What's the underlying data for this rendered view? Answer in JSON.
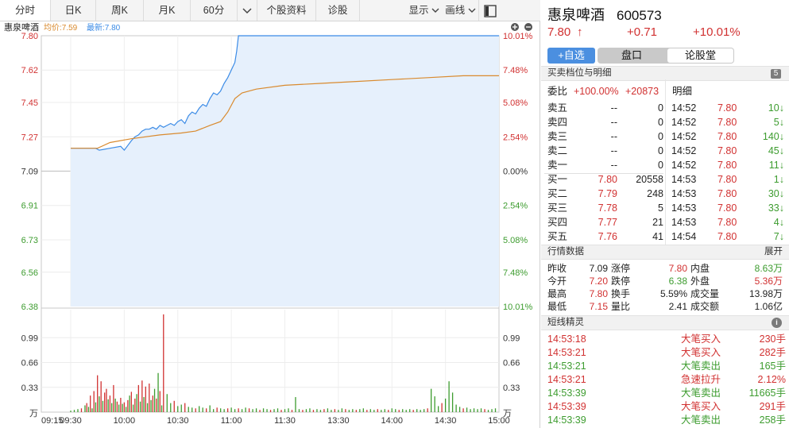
{
  "toolbar": {
    "tabs": [
      "分时",
      "日K",
      "周K",
      "月K",
      "60分"
    ],
    "dropdown_icon": "chevron-down-icon",
    "tabs2": [
      "个股资料",
      "诊股"
    ],
    "display_label": "显示",
    "draw_label": "画线",
    "layout_icon": "panel-toggle-icon"
  },
  "chart_header": {
    "name": "惠泉啤酒",
    "avg_label": "均价:7.59",
    "latest_label": "最新:7.80",
    "zoom_in_icon": "plus-circle-icon",
    "zoom_out_icon": "minus-circle-icon"
  },
  "colors": {
    "up": "#d13131",
    "down": "#3d9c2f",
    "price_line": "#3b8be6",
    "avg_line": "#d98a2e",
    "fill": "#e6f0fc"
  },
  "chart_data": [
    {
      "type": "line",
      "title": "",
      "y_left_ticks": [
        "7.80",
        "7.62",
        "7.45",
        "7.27",
        "7.09",
        "6.91",
        "6.73",
        "6.56",
        "6.38"
      ],
      "y_right_ticks": [
        "10.01%",
        "7.48%",
        "5.08%",
        "2.54%",
        "0.00%",
        "2.54%",
        "5.08%",
        "7.48%",
        "10.01%"
      ],
      "ylim": [
        6.38,
        7.8
      ],
      "x_ticks": [
        "09:15",
        "09:30",
        "10:00",
        "10:30",
        "11:00",
        "11:30",
        "13:30",
        "14:00",
        "14:30",
        "15:00"
      ],
      "series": [
        {
          "name": "最新",
          "points": [
            [
              0,
              7.21
            ],
            [
              14,
              7.21
            ],
            [
              16,
              7.2
            ],
            [
              22,
              7.21
            ],
            [
              28,
              7.22
            ],
            [
              30,
              7.2
            ],
            [
              34,
              7.25
            ],
            [
              36,
              7.27
            ],
            [
              38,
              7.28
            ],
            [
              40,
              7.3
            ],
            [
              42,
              7.31
            ],
            [
              44,
              7.31
            ],
            [
              46,
              7.32
            ],
            [
              48,
              7.31
            ],
            [
              50,
              7.33
            ],
            [
              52,
              7.32
            ],
            [
              54,
              7.33
            ],
            [
              56,
              7.34
            ],
            [
              58,
              7.33
            ],
            [
              60,
              7.35
            ],
            [
              62,
              7.36
            ],
            [
              64,
              7.34
            ],
            [
              66,
              7.38
            ],
            [
              68,
              7.4
            ],
            [
              70,
              7.39
            ],
            [
              72,
              7.42
            ],
            [
              74,
              7.44
            ],
            [
              76,
              7.43
            ],
            [
              78,
              7.47
            ],
            [
              80,
              7.5
            ],
            [
              82,
              7.49
            ],
            [
              84,
              7.51
            ],
            [
              86,
              7.55
            ],
            [
              88,
              7.58
            ],
            [
              90,
              7.62
            ],
            [
              92,
              7.66
            ],
            [
              93,
              7.72
            ],
            [
              94,
              7.8
            ],
            [
              240,
              7.8
            ]
          ]
        },
        {
          "name": "均价",
          "points": [
            [
              0,
              7.21
            ],
            [
              15,
              7.21
            ],
            [
              22,
              7.24
            ],
            [
              34,
              7.26
            ],
            [
              50,
              7.28
            ],
            [
              62,
              7.29
            ],
            [
              70,
              7.3
            ],
            [
              78,
              7.33
            ],
            [
              84,
              7.35
            ],
            [
              88,
              7.4
            ],
            [
              92,
              7.47
            ],
            [
              96,
              7.5
            ],
            [
              104,
              7.52
            ],
            [
              120,
              7.54
            ],
            [
              140,
              7.55
            ],
            [
              160,
              7.56
            ],
            [
              180,
              7.57
            ],
            [
              200,
              7.58
            ],
            [
              220,
              7.59
            ],
            [
              240,
              7.59
            ]
          ]
        }
      ]
    },
    {
      "type": "bar",
      "title": "",
      "unit": "万",
      "y_ticks": [
        "0.99",
        "0.66",
        "0.33"
      ],
      "ylim": [
        0,
        1.32
      ],
      "x_minutes": [
        0,
        2,
        4,
        6,
        8,
        9,
        10,
        11,
        12,
        13,
        14,
        15,
        16,
        17,
        18,
        19,
        20,
        21,
        22,
        23,
        24,
        25,
        26,
        27,
        28,
        29,
        30,
        31,
        32,
        33,
        34,
        35,
        36,
        37,
        38,
        39,
        40,
        41,
        42,
        43,
        44,
        45,
        46,
        47,
        48,
        49,
        50,
        51,
        52,
        54,
        56,
        58,
        60,
        62,
        64,
        66,
        68,
        70,
        72,
        74,
        76,
        78,
        80,
        82,
        84,
        86,
        88,
        90,
        92,
        94,
        96,
        98,
        100,
        102,
        104,
        106,
        108,
        110,
        112,
        114,
        116,
        118,
        120,
        122,
        124,
        126,
        128,
        130,
        132,
        134,
        136,
        138,
        140,
        142,
        144,
        146,
        148,
        150,
        152,
        154,
        156,
        158,
        160,
        162,
        164,
        166,
        168,
        170,
        172,
        174,
        176,
        178,
        180,
        182,
        184,
        186,
        188,
        190,
        192,
        194,
        196,
        198,
        200,
        202,
        204,
        206,
        208,
        210,
        212,
        214,
        216,
        218,
        220,
        222,
        224,
        226,
        228,
        230,
        232,
        234,
        236,
        238
      ],
      "values": [
        0.02,
        0.03,
        0.04,
        0.05,
        0.09,
        0.12,
        0.07,
        0.22,
        0.05,
        0.28,
        0.13,
        0.49,
        0.21,
        0.41,
        0.15,
        0.26,
        0.31,
        0.17,
        0.22,
        0.12,
        0.36,
        0.18,
        0.14,
        0.1,
        0.19,
        0.11,
        0.13,
        0.07,
        0.16,
        0.22,
        0.27,
        0.1,
        0.18,
        0.24,
        0.36,
        0.14,
        0.42,
        0.2,
        0.34,
        0.12,
        0.38,
        0.16,
        0.22,
        0.31,
        0.18,
        0.52,
        0.28,
        0.09,
        1.3,
        0.24,
        0.12,
        0.15,
        0.08,
        0.1,
        0.12,
        0.07,
        0.06,
        0.05,
        0.08,
        0.06,
        0.05,
        0.09,
        0.04,
        0.06,
        0.05,
        0.04,
        0.05,
        0.06,
        0.04,
        0.05,
        0.04,
        0.06,
        0.05,
        0.04,
        0.05,
        0.03,
        0.05,
        0.04,
        0.03,
        0.04,
        0.05,
        0.03,
        0.04,
        0.05,
        0.03,
        0.2,
        0.04,
        0.03,
        0.04,
        0.05,
        0.03,
        0.04,
        0.03,
        0.04,
        0.05,
        0.03,
        0.04,
        0.03,
        0.05,
        0.04,
        0.03,
        0.04,
        0.03,
        0.04,
        0.05,
        0.03,
        0.04,
        0.03,
        0.04,
        0.03,
        0.04,
        0.03,
        0.05,
        0.04,
        0.03,
        0.04,
        0.03,
        0.04,
        0.03,
        0.04,
        0.03,
        0.04,
        0.05,
        0.31,
        0.21,
        0.08,
        0.12,
        0.18,
        0.41,
        0.26,
        0.1,
        0.07,
        0.05,
        0.06,
        0.04,
        0.05,
        0.04,
        0.05,
        0.04,
        0.03,
        0.04,
        0.05
      ],
      "colors": [
        "g",
        "g",
        "g",
        "r",
        "g",
        "r",
        "g",
        "r",
        "g",
        "r",
        "g",
        "r",
        "g",
        "r",
        "g",
        "r",
        "r",
        "g",
        "r",
        "g",
        "r",
        "g",
        "r",
        "g",
        "r",
        "g",
        "r",
        "g",
        "r",
        "g",
        "r",
        "g",
        "r",
        "g",
        "r",
        "g",
        "r",
        "g",
        "r",
        "g",
        "r",
        "g",
        "r",
        "g",
        "r",
        "g",
        "r",
        "g",
        "r",
        "g",
        "g",
        "r",
        "g",
        "g",
        "r",
        "g",
        "g",
        "r",
        "g",
        "g",
        "r",
        "g",
        "g",
        "r",
        "g",
        "g",
        "r",
        "g",
        "g",
        "r",
        "g",
        "g",
        "r",
        "g",
        "g",
        "r",
        "g",
        "g",
        "r",
        "g",
        "g",
        "r",
        "g",
        "g",
        "r",
        "g",
        "g",
        "r",
        "g",
        "g",
        "r",
        "g",
        "g",
        "r",
        "g",
        "g",
        "r",
        "g",
        "g",
        "r",
        "g",
        "g",
        "r",
        "g",
        "g",
        "r",
        "g",
        "g",
        "r",
        "g",
        "g",
        "r",
        "g",
        "g",
        "r",
        "g",
        "g",
        "g",
        "r",
        "g",
        "g",
        "g",
        "r",
        "g",
        "g",
        "g",
        "r",
        "g",
        "g",
        "g",
        "g",
        "g",
        "r",
        "g",
        "g",
        "g",
        "g",
        "g",
        "r",
        "g",
        "g"
      ]
    }
  ],
  "quote": {
    "name": "惠泉啤酒",
    "code": "600573",
    "price": "7.80",
    "arrow": "↑",
    "change": "+0.71",
    "change_pct": "+10.01%"
  },
  "actions": {
    "add_watch": "+自选",
    "tab_pankou": "盘口",
    "tab_lungu": "论股堂"
  },
  "orderbook": {
    "header": "买卖档位与明细",
    "badge": "5",
    "weibi_label": "委比",
    "weibi_pct": "+100.00%",
    "weibi_diff": "+20873",
    "detail_label": "明细",
    "asks": [
      {
        "label": "卖五",
        "price": "--",
        "vol": "0"
      },
      {
        "label": "卖四",
        "price": "--",
        "vol": "0"
      },
      {
        "label": "卖三",
        "price": "--",
        "vol": "0"
      },
      {
        "label": "卖二",
        "price": "--",
        "vol": "0"
      },
      {
        "label": "卖一",
        "price": "--",
        "vol": "0"
      }
    ],
    "bids": [
      {
        "label": "买一",
        "price": "7.80",
        "vol": "20558"
      },
      {
        "label": "买二",
        "price": "7.79",
        "vol": "248"
      },
      {
        "label": "买三",
        "price": "7.78",
        "vol": "5"
      },
      {
        "label": "买四",
        "price": "7.77",
        "vol": "21"
      },
      {
        "label": "买五",
        "price": "7.76",
        "vol": "41"
      }
    ],
    "ticks": [
      {
        "time": "14:52",
        "price": "7.80",
        "vol": "10↓"
      },
      {
        "time": "14:52",
        "price": "7.80",
        "vol": "5↓"
      },
      {
        "time": "14:52",
        "price": "7.80",
        "vol": "140↓"
      },
      {
        "time": "14:52",
        "price": "7.80",
        "vol": "45↓"
      },
      {
        "time": "14:52",
        "price": "7.80",
        "vol": "11↓"
      },
      {
        "time": "14:53",
        "price": "7.80",
        "vol": "1↓"
      },
      {
        "time": "14:53",
        "price": "7.80",
        "vol": "30↓"
      },
      {
        "time": "14:53",
        "price": "7.80",
        "vol": "33↓"
      },
      {
        "time": "14:53",
        "price": "7.80",
        "vol": "4↓"
      },
      {
        "time": "14:54",
        "price": "7.80",
        "vol": "7↓"
      }
    ]
  },
  "market": {
    "header": "行情数据",
    "expand": "展开",
    "rows": [
      {
        "l1": "昨收",
        "v1": "7.09",
        "l2": "涨停",
        "v2": "7.80",
        "l3": "内盘",
        "v3": "8.63万"
      },
      {
        "l1": "今开",
        "v1": "7.20",
        "l2": "跌停",
        "v2": "6.38",
        "l3": "外盘",
        "v3": "5.36万"
      },
      {
        "l1": "最高",
        "v1": "7.80",
        "l2": "换手",
        "v2": "5.59%",
        "l3": "成交量",
        "v3": "13.98万"
      },
      {
        "l1": "最低",
        "v1": "7.15",
        "l2": "量比",
        "v2": "2.41",
        "l3": "成交额",
        "v3": "1.06亿"
      }
    ]
  },
  "shortline": {
    "header": "短线精灵",
    "info_icon": "info-icon",
    "info_glyph": "i",
    "items": [
      {
        "time": "14:53:18",
        "type": "大笔买入",
        "value": "230手",
        "dir": "up"
      },
      {
        "time": "14:53:21",
        "type": "大笔买入",
        "value": "282手",
        "dir": "up"
      },
      {
        "time": "14:53:21",
        "type": "大笔卖出",
        "value": "165手",
        "dir": "down"
      },
      {
        "time": "14:53:21",
        "type": "急速拉升",
        "value": "2.12%",
        "dir": "up"
      },
      {
        "time": "14:53:39",
        "type": "大笔卖出",
        "value": "11665手",
        "dir": "down"
      },
      {
        "time": "14:53:39",
        "type": "大笔买入",
        "value": "291手",
        "dir": "up"
      },
      {
        "time": "14:53:39",
        "type": "大笔卖出",
        "value": "258手",
        "dir": "down"
      }
    ]
  }
}
